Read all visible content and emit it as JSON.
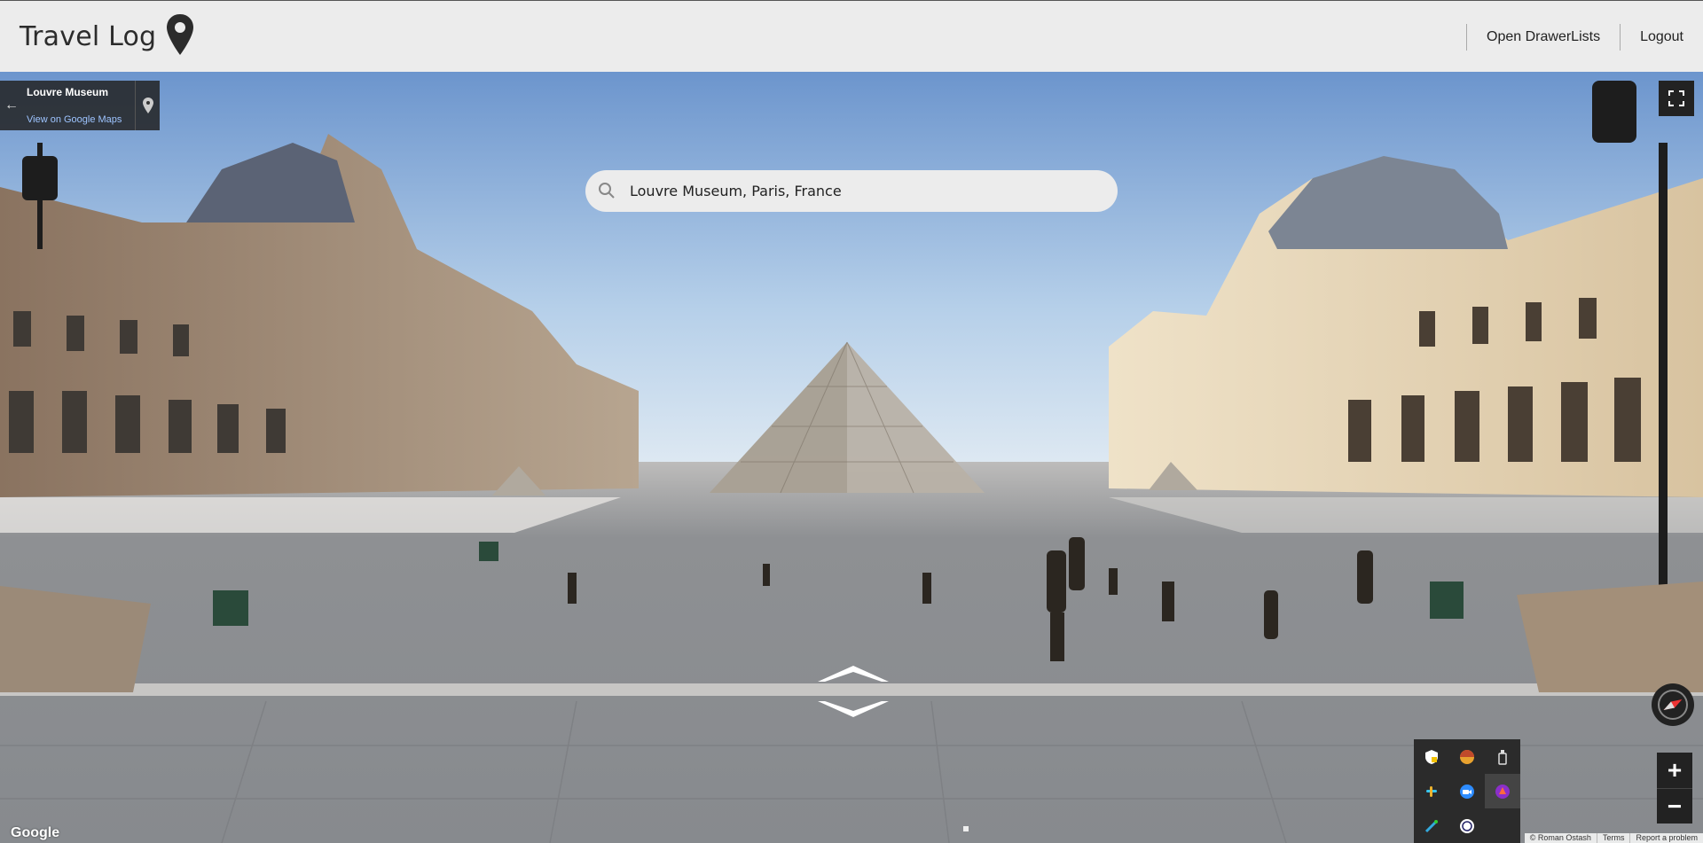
{
  "header": {
    "title": "Travel Log",
    "nav": [
      {
        "label": "Open DrawerLists"
      },
      {
        "label": "Logout"
      }
    ]
  },
  "place_card": {
    "title": "Louvre Museum",
    "link": "View on Google Maps",
    "back_icon": "←"
  },
  "search": {
    "value": "Louvre Museum, Paris, France",
    "icon": "search-icon"
  },
  "controls": {
    "zoom_in": "+",
    "zoom_out": "−"
  },
  "tray_icons": [
    "shield-icon",
    "colorful-disc-icon",
    "usb-drive-icon",
    "slack-icon",
    "zoom-icon",
    "app-icon",
    "pen-icon",
    "bluetooth-icon"
  ],
  "attribution": {
    "logo": "Google",
    "items": [
      "© Roman Ostash",
      "Terms",
      "Report a problem"
    ]
  },
  "colors": {
    "header_bg": "#ececec",
    "control_bg": "#222222",
    "sky": "#8db2dc",
    "pavement": "#8b8d90"
  }
}
